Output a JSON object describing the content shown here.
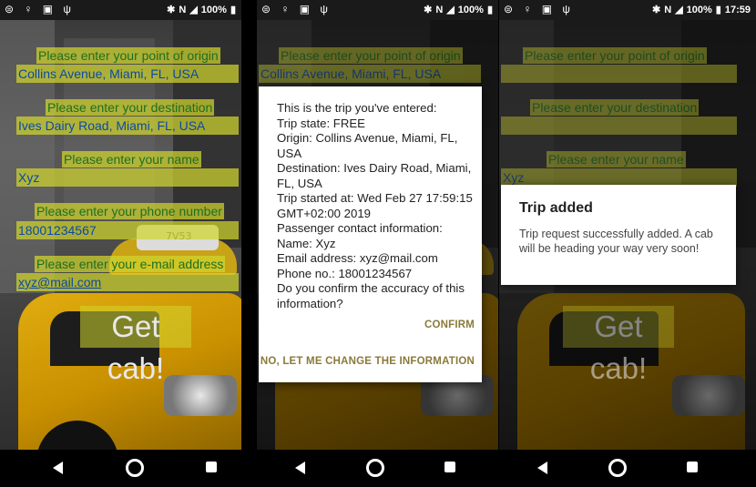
{
  "status_bar": {
    "left_icons": [
      "whatsapp-icon",
      "lightbulb-icon",
      "image-icon",
      "usb-icon"
    ],
    "battery": "100%",
    "time": "17:59"
  },
  "form": {
    "origin_label": "Please enter your point of origin",
    "origin_value": "Collins Avenue, Miami, FL, USA",
    "destination_label": "Please enter your destination",
    "destination_value": "Ives Dairy Road, Miami, FL, USA",
    "name_label": "Please enter your name",
    "name_value": "Xyz",
    "phone_label": "Please enter your phone number",
    "phone_value": "18001234567",
    "email_label": "Please enter your e-mail address",
    "email_value": "xyz@mail.com",
    "get_cab_label": "Get cab!"
  },
  "confirm_dialog": {
    "lines": [
      "This is the trip you've entered:",
      "Trip state: FREE",
      "Origin: Collins Avenue, Miami, FL, USA",
      "Destination: Ives Dairy Road, Miami, FL, USA",
      "Trip started at: Wed Feb 27 17:59:15 GMT+02:00 2019",
      "Passenger contact information:",
      "Name: Xyz",
      "Email address: xyz@mail.com",
      "Phone no.: 18001234567",
      "Do you confirm the accuracy of this information?"
    ],
    "confirm_label": "CONFIRM",
    "change_label": "NO, LET ME CHANGE THE INFORMATION"
  },
  "added_dialog": {
    "title": "Trip added",
    "message": "Trip request successfully added. A cab will be heading your way very soon!"
  },
  "taxi_sign_text": "7V53",
  "colors": {
    "field_highlight": "#d1d52e",
    "label_text": "#1f6f1f",
    "field_text": "#0a4aa6",
    "dialog_button": "#8a7a3a"
  }
}
